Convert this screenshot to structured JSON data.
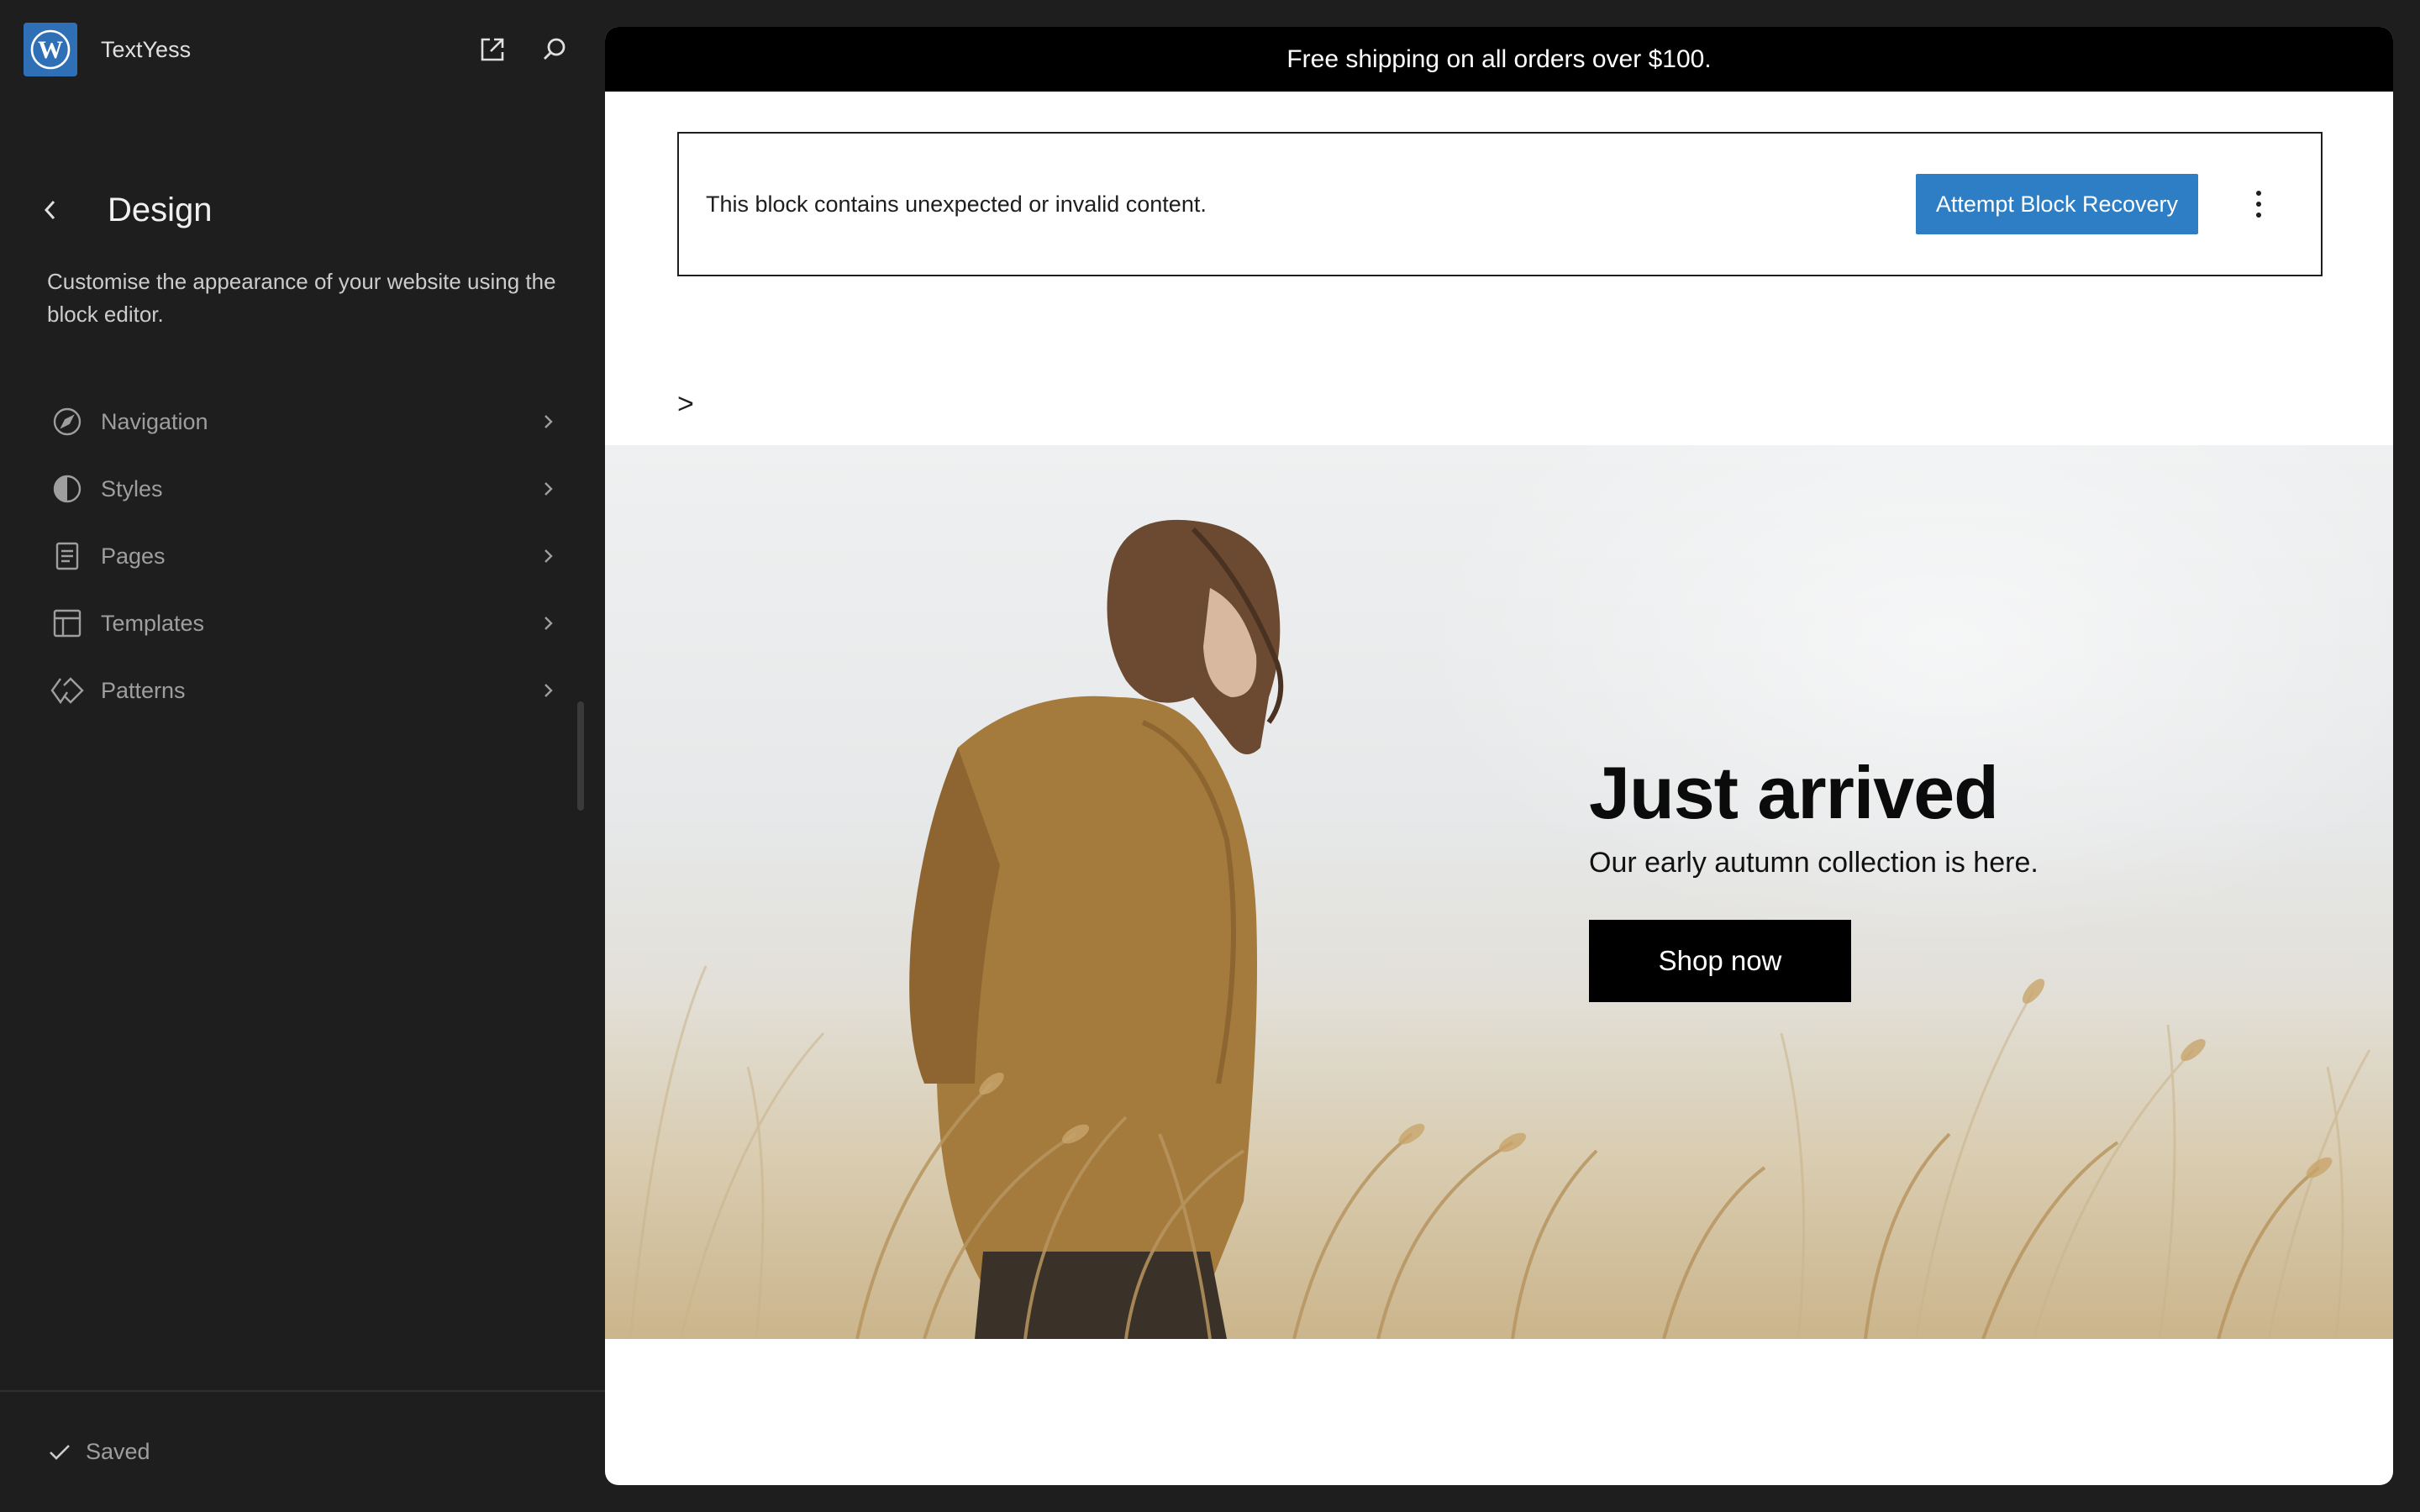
{
  "site": {
    "title": "TextYess",
    "logo_icon": "wordpress-logo",
    "open_site_icon": "external-link-icon",
    "search_icon": "search-icon"
  },
  "panel": {
    "title": "Design",
    "description": "Customise the appearance of your website using the block editor.",
    "items": [
      {
        "label": "Navigation",
        "icon": "navigation-compass-icon"
      },
      {
        "label": "Styles",
        "icon": "styles-half-circle-icon"
      },
      {
        "label": "Pages",
        "icon": "page-icon"
      },
      {
        "label": "Templates",
        "icon": "layout-icon"
      },
      {
        "label": "Patterns",
        "icon": "symbol-diamond-icon"
      }
    ]
  },
  "footer": {
    "status": "Saved"
  },
  "canvas": {
    "promo": "Free shipping on all orders over $100.",
    "invalid_block": {
      "message": "This block contains unexpected or invalid content.",
      "button": "Attempt Block Recovery"
    },
    "stray_text": ">",
    "hero": {
      "title": "Just arrived",
      "subtitle": "Our early autumn collection is here.",
      "button": "Shop now"
    }
  },
  "colors": {
    "sidebar_bg": "#1e1e1e",
    "accent": "#2d7ec4",
    "promo_bg": "#000000"
  }
}
